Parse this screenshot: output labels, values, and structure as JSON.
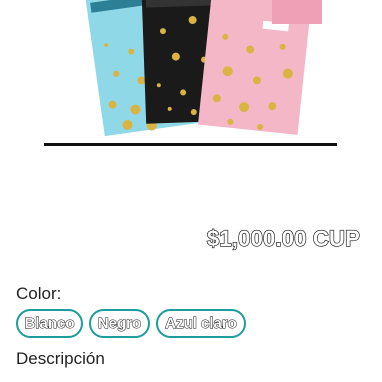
{
  "product": {
    "price": "$1,000.00 CUP"
  },
  "options": {
    "color_label": "Color:",
    "colors": [
      "Blanco",
      "Negro",
      "Azul claro"
    ]
  },
  "description": {
    "heading": "Descripción"
  }
}
